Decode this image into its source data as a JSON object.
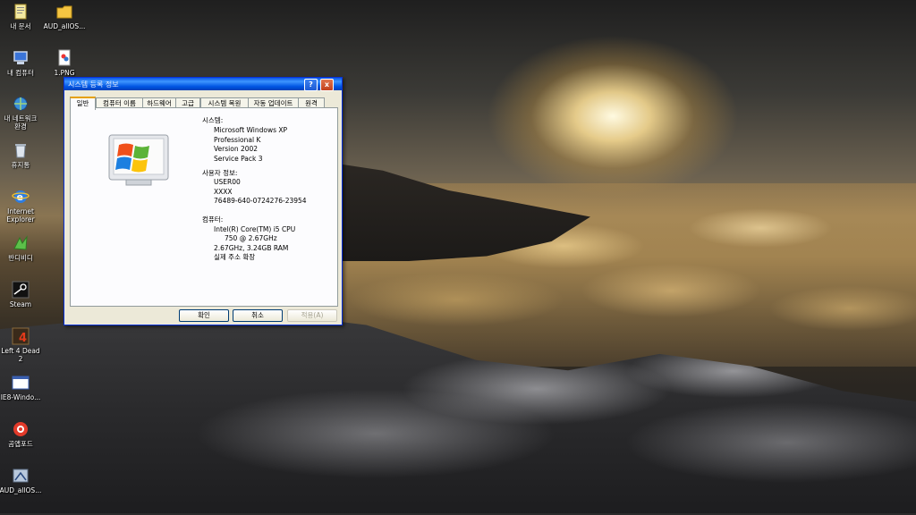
{
  "desktop": {
    "icons": [
      {
        "label": "내 문서",
        "icon": "my-documents-icon"
      },
      {
        "label": "AUD_allOS...",
        "icon": "folder-icon"
      },
      {
        "label": "내 컴퓨터",
        "icon": "my-computer-icon"
      },
      {
        "label": "1.PNG",
        "icon": "image-file-icon"
      },
      {
        "label": "내 네트워크\n환경",
        "icon": "network-icon"
      },
      {
        "label": "휴지통",
        "icon": "recycle-bin-icon"
      },
      {
        "label": "Internet\nExplorer",
        "icon": "internet-explorer-icon"
      },
      {
        "label": "반디비디",
        "icon": "bandizip-icon"
      },
      {
        "label": "Steam",
        "icon": "steam-icon"
      },
      {
        "label": "Left 4 Dead\n2",
        "icon": "left4dead2-icon"
      },
      {
        "label": "IE8-Windo...",
        "icon": "installer-icon"
      },
      {
        "label": "곰앱포드",
        "icon": "app-icon"
      },
      {
        "label": "AUD_allOS...",
        "icon": "shortcut-icon"
      }
    ]
  },
  "dialog": {
    "title": "시스템 등록 정보",
    "help_label": "?",
    "close_label": "x",
    "tabs": [
      "일반",
      "컴퓨터 이름",
      "하드웨어",
      "고급",
      "시스템 복원",
      "자동 업데이트",
      "원격"
    ],
    "system_heading": "시스템:",
    "system_lines": [
      "Microsoft Windows XP",
      "Professional K",
      "Version 2002",
      "Service Pack 3"
    ],
    "user_heading": "사용자 정보:",
    "user_lines": [
      "USER00",
      "XXXX",
      "76489-640-0724276-23954"
    ],
    "computer_heading": "컴퓨터:",
    "computer_lines": [
      "Intel(R) Core(TM) i5 CPU",
      "750  @ 2.67GHz",
      "2.67GHz, 3.24GB RAM",
      "실제 주소 확장"
    ],
    "buttons": {
      "ok": "확인",
      "cancel": "취소",
      "apply": "적용(A)"
    }
  }
}
